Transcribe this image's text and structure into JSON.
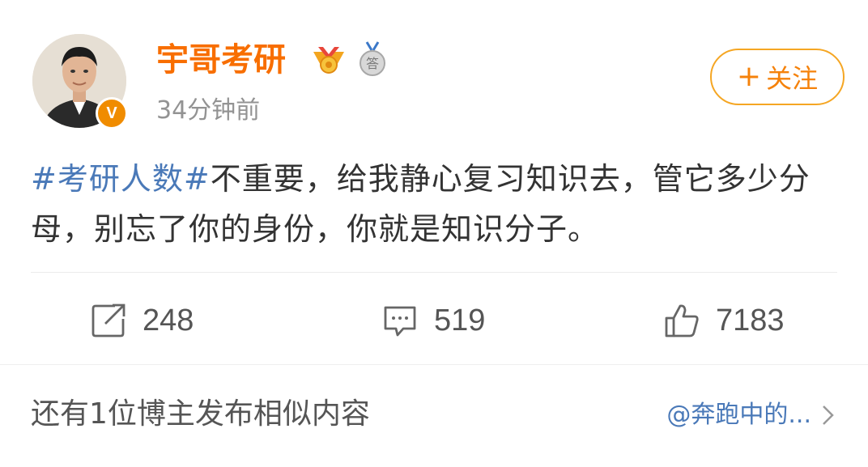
{
  "post": {
    "author": {
      "name": "宇哥考研",
      "verified_badge": "V",
      "answer_badge_char": "答"
    },
    "time": "34分钟前",
    "follow_label": "关注",
    "follow_plus": "+",
    "content": {
      "topic": "#考研人数#",
      "text": "不重要，给我静心复习知识去，管它多少分母，别忘了你的身份，你就是知识分子。"
    },
    "actions": {
      "repost": {
        "icon": "repost-icon",
        "count": "248"
      },
      "comment": {
        "icon": "comment-icon",
        "count": "519"
      },
      "like": {
        "icon": "thumbs-up-icon",
        "count": "7183"
      }
    }
  },
  "similar": {
    "text": "还有1位博主发布相似内容",
    "link": "@奔跑中的..."
  },
  "colors": {
    "username": "#f86e00",
    "topic": "#4a79b8",
    "follow_border": "#f5a623",
    "verified": "#f08c00"
  }
}
